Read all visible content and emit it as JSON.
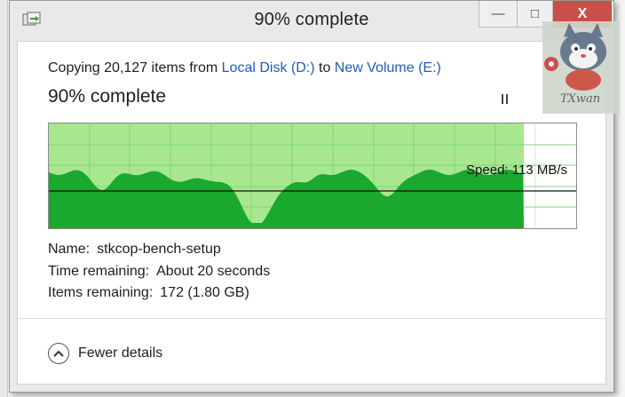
{
  "window": {
    "title": "90% complete",
    "minimize_label": "—",
    "maximize_label": "□",
    "close_label": "X"
  },
  "copy": {
    "prefix": "Copying 20,127 items from ",
    "source": "Local Disk (D:)",
    "connector": " to ",
    "destination": "New Volume (E:)"
  },
  "progress": {
    "title": "90% complete",
    "percent": 0.9,
    "speed_text": "Speed: 113 MB/s",
    "speed_line_fraction": 0.64
  },
  "details": {
    "name_label": "Name:",
    "name_value": "stkcop-bench-setup",
    "time_label": "Time remaining:",
    "time_value": "About 20 seconds",
    "items_label": "Items remaining:",
    "items_value": "172 (1.80 GB)"
  },
  "footer": {
    "toggle_label": "Fewer details"
  },
  "watermark": {
    "text": "TXwan"
  },
  "colors": {
    "progress_fill": "#a8e68f",
    "throughput_fill": "#1aa82e",
    "grid_line": "#7fd67a",
    "link": "#1f5fb0",
    "close_button": "#c7504a"
  }
}
